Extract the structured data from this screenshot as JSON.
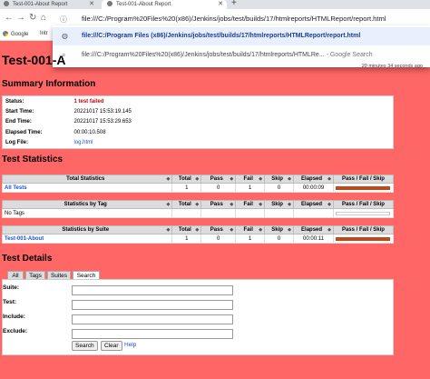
{
  "browser": {
    "tabs": [
      {
        "title": "Test-001-About Report"
      },
      {
        "title": "Test-001-About Report"
      }
    ],
    "new_tab": "+",
    "omnibox_text": "file:///C:/Program%20Files%20(x86)/Jenkins/jobs/test/builds/17/htmlreports/HTMLReport/report.html",
    "bookmarks": [
      {
        "label": "Google"
      },
      {
        "label": "Intr"
      }
    ],
    "dropdown": [
      {
        "text": "file:///C:/Program Files (x86)/Jenkins/jobs/test/builds/17/htmlreports/HTMLReport/report.html",
        "suffix": ""
      },
      {
        "text": "file:///C:/Program%20Files%20(x86)/Jenkins/jobs/test/builds/17/htmlreports/HTMLRe...",
        "suffix": " - Google Search"
      }
    ]
  },
  "report": {
    "title": "Test-001-A",
    "generated": "20 minutes 34 seconds ago"
  },
  "summary": {
    "heading": "Summary Information",
    "rows": [
      {
        "key": "Status:",
        "value": "1 test failed"
      },
      {
        "key": "Start Time:",
        "value": "20221017 15:53:19.145"
      },
      {
        "key": "End Time:",
        "value": "20221017 15:53:29.653"
      },
      {
        "key": "Elapsed Time:",
        "value": "00:00:10.508"
      },
      {
        "key": "Log File:",
        "value": "log.html"
      }
    ]
  },
  "statistics": {
    "heading": "Test Statistics",
    "columns": [
      "Total",
      "Pass",
      "Fail",
      "Skip",
      "Elapsed",
      "Pass / Fail / Skip"
    ],
    "total": {
      "header": "Total Statistics",
      "rows": [
        {
          "name": "All Tests",
          "total": "1",
          "pass": "0",
          "fail": "1",
          "skip": "0",
          "elapsed": "00:00:09"
        }
      ]
    },
    "tag": {
      "header": "Statistics by Tag",
      "rows": [
        {
          "name": "No Tags",
          "total": "",
          "pass": "",
          "fail": "",
          "skip": "",
          "elapsed": ""
        }
      ]
    },
    "suite": {
      "header": "Statistics by Suite",
      "rows": [
        {
          "name": "Test-001-About",
          "total": "1",
          "pass": "0",
          "fail": "1",
          "skip": "0",
          "elapsed": "00:00:11"
        }
      ]
    },
    "fail_fraction": 1.0,
    "fail_color": "#c2481a"
  },
  "details": {
    "heading": "Test Details",
    "tabs": [
      "All",
      "Tags",
      "Suites",
      "Search"
    ],
    "active_tab": "Search",
    "fields": [
      {
        "label": "Suite:",
        "value": ""
      },
      {
        "label": "Test:",
        "value": ""
      },
      {
        "label": "Include:",
        "value": ""
      },
      {
        "label": "Exclude:",
        "value": ""
      }
    ],
    "search_button": "Search",
    "clear_button": "Clear",
    "help_link": "Help"
  }
}
